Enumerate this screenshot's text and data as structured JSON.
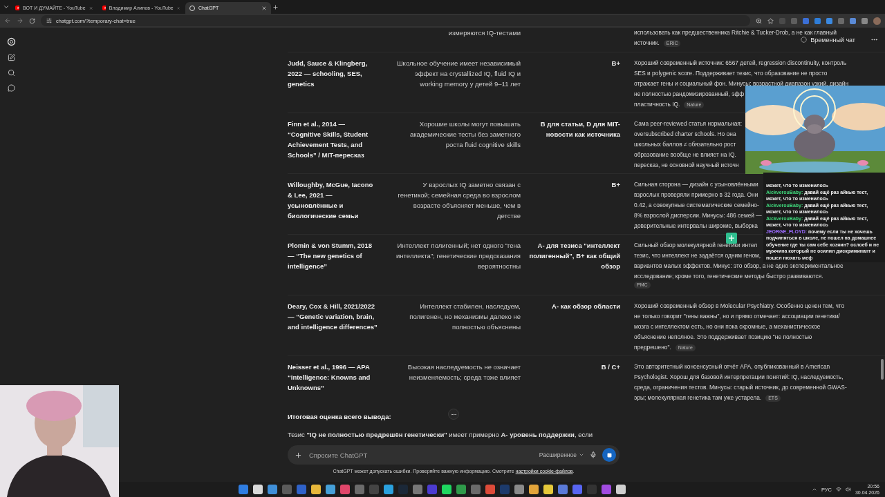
{
  "browser": {
    "tabs": [
      {
        "title": "ВОТ И ДУМАЙТЕ - YouTube",
        "selected": false,
        "kind": "video"
      },
      {
        "title": "Владимир Алипов - YouTube",
        "selected": false,
        "kind": "video"
      },
      {
        "title": "ChatGPT",
        "selected": true,
        "kind": "chat"
      }
    ],
    "url": "chatgpt.com/?temporary-chat=true"
  },
  "header": {
    "title": "Временный чат"
  },
  "table": {
    "rows": [
      {
        "claim": "измеряются IQ-тестами",
        "notes": [
          "использовать как предшественника Ritchie & Tucker-Drob, а не как главный",
          "источник."
        ],
        "badge": "ERIC",
        "badge_own_line": false
      },
      {
        "source": "Judd, Sauce & Klingberg, 2022 — schooling, SES, genetics",
        "claim": "Школьное обучение имеет независимый эффект на crystallized IQ, fluid IQ и working memory у детей 9–11 лет",
        "grade": "B+",
        "notes": [
          "Хороший современный источник: 6567 детей, regression discontinuity, контроль",
          "SES и polygenic score. Поддерживает тезис, что образование не просто",
          "отражает гены и социальный фон. Минусы: возрастной диапазон узкий, дизайн",
          "не полностью рандомизированный, эфф",
          "пластичность IQ."
        ],
        "badge": "Nature",
        "badge_own_line": false
      },
      {
        "source": "Finn et al., 2014 — “Cognitive Skills, Student Achievement Tests, and Schools” / MIT-пересказ",
        "claim": "Хорошие школы могут повышать академические тесты без заметного роста fluid cognitive skills",
        "grade": "B для статьи, D для MIT-новости как источника",
        "notes": [
          "Сама peer-reviewed статья нормальная:",
          "oversubscribed charter schools. Но она",
          "школьных баллов ≠ обязательно рост",
          "образование вообще не влияет на IQ.",
          "пересказ, не основной научный источн"
        ]
      },
      {
        "source": "Willoughby, McGue, Iacono & Lee, 2021 — усыновлённые и биологические семьи",
        "claim": "У взрослых IQ заметно связан с генетикой; семейная среда во взрослом возрасте объясняет меньше, чем в детстве",
        "grade": "B+",
        "notes": [
          "Сильная сторона — дизайн с усыновлёнными",
          "взрослых проверяли примерно в 32 года. Они",
          "0.42, а совокупные систематические семейно-",
          "8% взрослой дисперсии. Минусы: 486 семей —",
          "доверительные интервалы широкие, выборка"
        ]
      },
      {
        "source": "Plomin & von Stumm, 2018 — “The new genetics of intelligence”",
        "claim": "Интеллект полигенный; нет одного \"гена интеллекта\"; генетические предсказания вероятностны",
        "grade": "A- для тезиса \"интеллект полигенный\", B+ как общий обзор",
        "notes": [
          "Сильный обзор молекулярной генетики интел",
          "тезис, что интеллект не задаётся одним геном,",
          "вариантов малых эффектов. Минус: это обзор, а не одно экспериментальное",
          "исследование; кроме того, генетические методы быстро развиваются."
        ],
        "badge": "PMC",
        "badge_own_line": true
      },
      {
        "source": "Deary, Cox & Hill, 2021/2022 — “Genetic variation, brain, and intelligence differences”",
        "claim": "Интеллект стабилен, наследуем, полигенен, но механизмы далеко не полностью объяснены",
        "grade": "A- как обзор области",
        "notes": [
          "Хороший современный обзор в Molecular Psychiatry. Особенно ценен тем, что",
          "не только говорит \"гены важны\", но и прямо отмечает: ассоциации генетики/",
          "мозга с интеллектом есть, но они пока скромные, а механистическое",
          "объяснение неполное. Это поддерживает позицию \"не полностью",
          "предрешено\"."
        ],
        "badge": "Nature",
        "badge_own_line": false
      },
      {
        "source": "Neisser et al., 1996 — APA “Intelligence: Knowns and Unknowns”",
        "claim": "Высокая наследуемость не означает неизменяемость; среда тоже влияет",
        "grade": "B / C+",
        "notes": [
          "Это авторитетный консенсусный отчёт APA, опубликованный в American",
          "Psychologist. Хорош для базовой интерпретации понятий: IQ, наследуемость,",
          "среда, ограничения тестов. Минусы: старый источник, до современной GWAS-",
          "эры; молекулярная генетика там уже устарела."
        ],
        "badge": "ETS",
        "badge_own_line": false
      }
    ]
  },
  "summary": {
    "heading": "Итоговая оценка всего вывода:",
    "text": "Тезис **\"IQ не полностью предрешён генетически\"** имеет примерно **A- уровень поддержки**, если"
  },
  "composer": {
    "placeholder": "Спросите ChatGPT",
    "mode": "Расширенное"
  },
  "disclaimer": {
    "text": "ChatGPT может допускать ошибки. Проверяйте важную информацию. Смотрите",
    "link": "настройки cookie-файлов",
    "tail": "."
  },
  "chat_overlay": {
    "messages": [
      {
        "text": "может, что то изменилось"
      },
      {
        "author": "AickverouBaby:",
        "color": "#3fd67a",
        "text": "давай ещё раз айкью тест, может, что то изменилось"
      },
      {
        "author": "AickverouBaby:",
        "color": "#3fd67a",
        "text": "давай ещё раз айкью тест, может, что то изменилось"
      },
      {
        "author": "AickverouBaby:",
        "color": "#3fd67a",
        "text": "давай ещё раз айкью тест, может, что то изменилось"
      },
      {
        "author": "JEORGE_FLOYD:",
        "color": "#9b6bff",
        "text": "почему если ты не хочешь подчиняться в школе, не пошел на домашнее обучение где ты сам себе хозяин? ослоеб и не мужчина который не осилил дискриминант и пошел нюхать меф"
      }
    ]
  },
  "taskbar": {
    "language": "РУС",
    "time": "20:56",
    "date": "30.04.2026"
  }
}
